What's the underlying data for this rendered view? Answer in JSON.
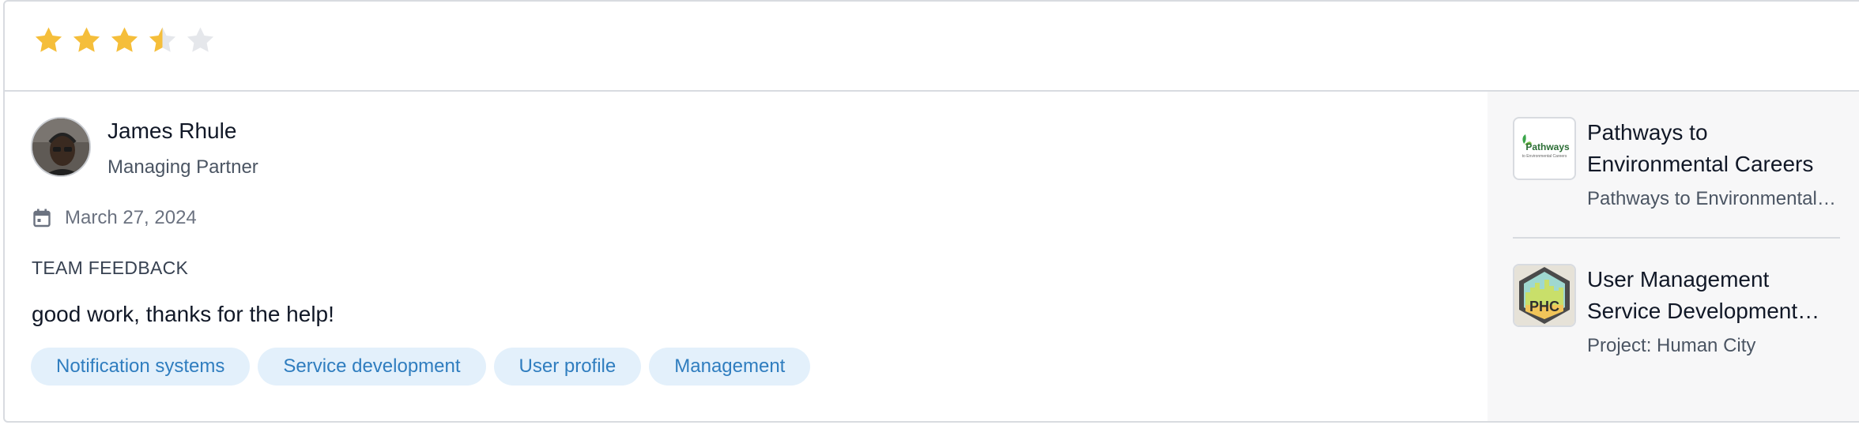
{
  "rating": {
    "value": 3.5,
    "max": 5,
    "filled_color": "#f5be3a",
    "empty_color": "#e5e7eb"
  },
  "review": {
    "author_name": "James Rhule",
    "author_role": "Managing Partner",
    "date": "March 27, 2024",
    "section_label": "TEAM FEEDBACK",
    "text": "good work, thanks for the help!",
    "tags": [
      "Notification systems",
      "Service development",
      "User profile",
      "Management"
    ]
  },
  "sidebar": {
    "items": [
      {
        "title_line1": "Pathways to",
        "title_line2": "Environmental Careers",
        "subtitle": "Pathways to Environmental…",
        "logo_text": "Pathways",
        "logo_subtext": "to Environmental Careers",
        "icon": "pathways-logo"
      },
      {
        "title_line1": "User Management",
        "title_line2": "Service Development…",
        "subtitle": "Project: Human City",
        "logo_text": "PHC",
        "icon": "phc-logo"
      }
    ]
  }
}
